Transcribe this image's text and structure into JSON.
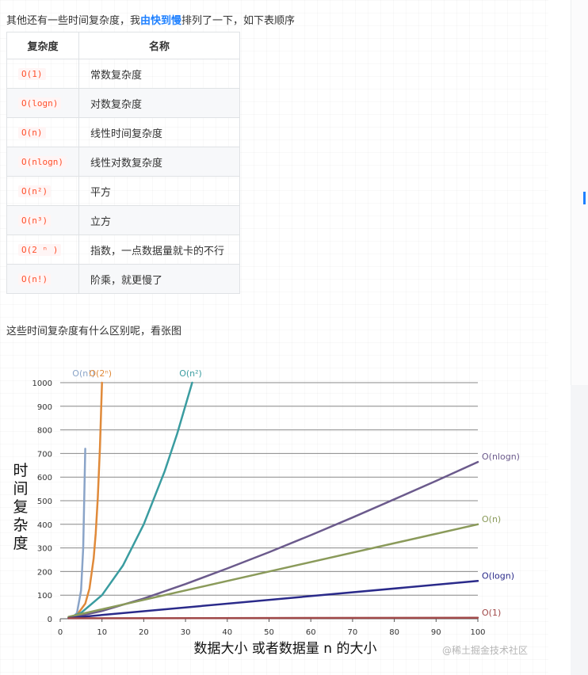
{
  "intro": {
    "before": "其他还有一些时间复杂度，我",
    "highlight": "由快到慢",
    "after": "排列了一下，如下表顺序"
  },
  "table": {
    "headers": [
      "复杂度",
      "名称"
    ],
    "rows": [
      {
        "code": "O(1)",
        "name": "常数复杂度"
      },
      {
        "code": "O(logn)",
        "name": "对数复杂度"
      },
      {
        "code": "O(n)",
        "name": "线性时间复杂度"
      },
      {
        "code": "O(nlogn)",
        "name": "线性对数复杂度"
      },
      {
        "code": "O(n²)",
        "name": "平方"
      },
      {
        "code": "O(n³)",
        "name": "立方"
      },
      {
        "code": "O(2 ⁿ )",
        "name": "指数，一点数据量就卡的不行"
      },
      {
        "code": "O(n!)",
        "name": "阶乘，就更慢了"
      }
    ]
  },
  "after_text": "这些时间复杂度有什么区别呢，看张图",
  "watermark": "@稀土掘金技术社区",
  "chart_data": {
    "type": "line",
    "xlabel": "数据大小 或者数据量 n 的大小",
    "ylabel": "时间复杂度",
    "xlim": [
      0,
      100
    ],
    "ylim": [
      0,
      1000
    ],
    "xticks": [
      0,
      10,
      20,
      30,
      40,
      50,
      60,
      70,
      80,
      90,
      100
    ],
    "yticks": [
      0,
      100,
      200,
      300,
      400,
      500,
      600,
      700,
      800,
      900,
      1000
    ],
    "grid": true,
    "series": [
      {
        "name": "O(n!)",
        "color": "#8aa4c8",
        "x": [
          2,
          3,
          4,
          5,
          5.5,
          6
        ],
        "y": [
          2,
          6,
          24,
          120,
          300,
          720
        ],
        "label_pos": "top"
      },
      {
        "name": "O(2ⁿ)",
        "color": "#e08a3a",
        "x": [
          2,
          4,
          6,
          7,
          8,
          8.5,
          9,
          9.5,
          10
        ],
        "y": [
          4,
          16,
          64,
          128,
          256,
          362,
          512,
          724,
          1000
        ],
        "label_pos": "top"
      },
      {
        "name": "O(n²)",
        "color": "#3a9ca0",
        "x": [
          2,
          5,
          10,
          15,
          20,
          25,
          28,
          31.6
        ],
        "y": [
          4,
          25,
          100,
          225,
          400,
          625,
          784,
          1000
        ],
        "label_pos": "top"
      },
      {
        "name": "O(nlogn)",
        "color": "#6b5a8c",
        "x": [
          2,
          10,
          20,
          30,
          40,
          50,
          60,
          70,
          80,
          90,
          100
        ],
        "y": [
          2,
          33,
          86,
          147,
          213,
          282,
          354,
          429,
          506,
          584,
          664
        ],
        "label_pos": "right"
      },
      {
        "name": "O(n)",
        "color": "#8a9a5a",
        "x": [
          2,
          100
        ],
        "y": [
          8,
          400
        ],
        "label_pos": "right"
      },
      {
        "name": "O(logn)",
        "color": "#2a2a8a",
        "x": [
          2,
          100
        ],
        "y": [
          3,
          160
        ],
        "label_pos": "right"
      },
      {
        "name": "O(1)",
        "color": "#a04848",
        "x": [
          2,
          100
        ],
        "y": [
          2,
          4
        ],
        "label_pos": "right"
      }
    ]
  }
}
